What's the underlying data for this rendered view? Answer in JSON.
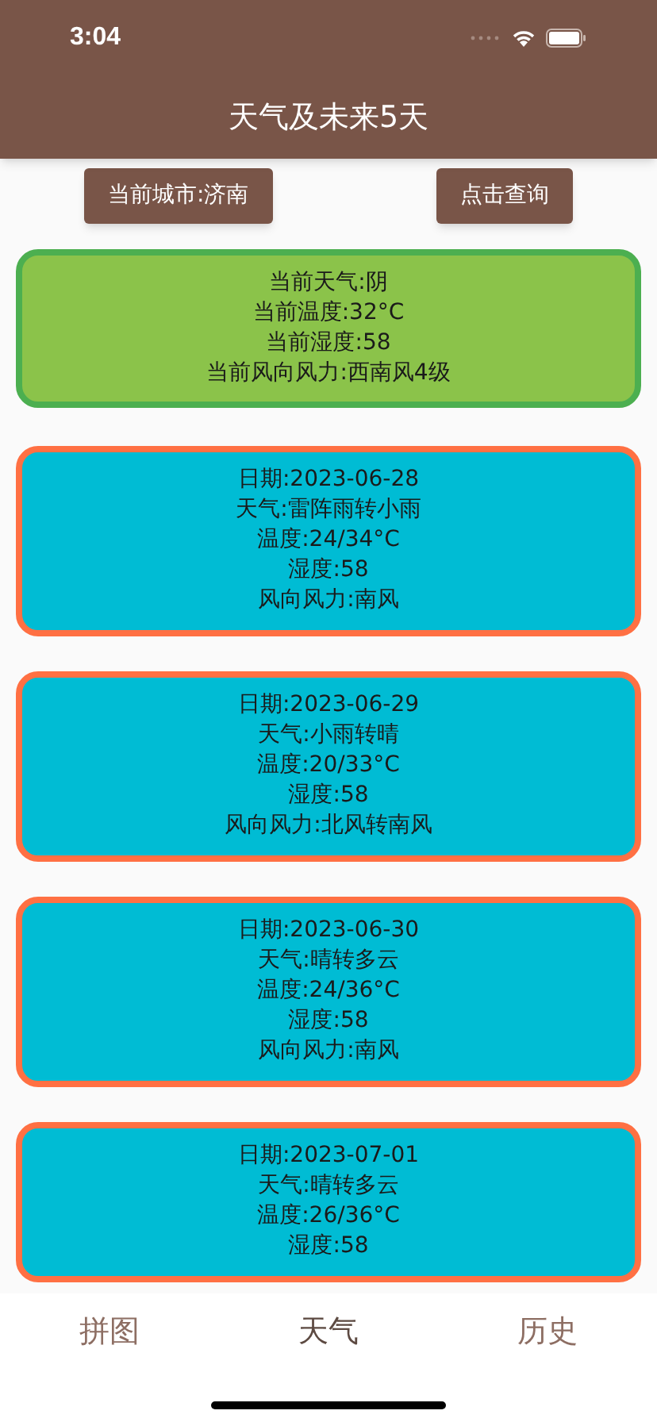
{
  "status_bar": {
    "time": "3:04"
  },
  "app_bar": {
    "title": "天气及未来5天"
  },
  "buttons": [
    {
      "label": "当前城市:济南"
    },
    {
      "label": "点击查询"
    }
  ],
  "current": {
    "lines": [
      "当前天气:阴",
      "当前温度:32°C",
      "当前湿度:58",
      "当前风向风力:西南风4级"
    ]
  },
  "forecast": [
    {
      "lines": [
        "日期:2023-06-28",
        "天气:雷阵雨转小雨",
        "温度:24/34°C",
        "湿度:58",
        "风向风力:南风"
      ]
    },
    {
      "lines": [
        "日期:2023-06-29",
        "天气:小雨转晴",
        "温度:20/33°C",
        "湿度:58",
        "风向风力:北风转南风"
      ]
    },
    {
      "lines": [
        "日期:2023-06-30",
        "天气:晴转多云",
        "温度:24/36°C",
        "湿度:58",
        "风向风力:南风"
      ]
    },
    {
      "lines": [
        "日期:2023-07-01",
        "天气:晴转多云",
        "温度:26/36°C",
        "湿度:58"
      ]
    }
  ],
  "bottom_nav": [
    {
      "label": "拼图",
      "selected": false
    },
    {
      "label": "天气",
      "selected": true
    },
    {
      "label": "历史",
      "selected": false
    }
  ]
}
